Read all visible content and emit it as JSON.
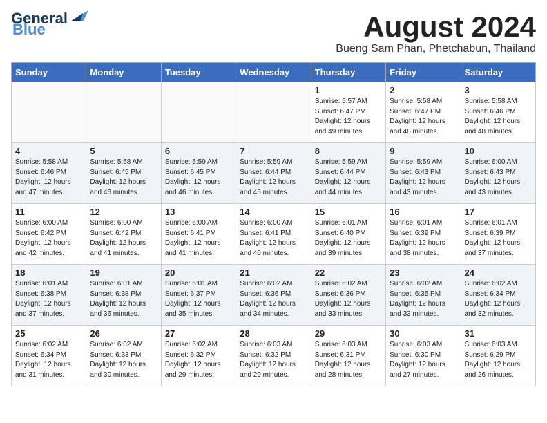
{
  "header": {
    "logo_line1": "General",
    "logo_line2": "Blue",
    "month_title": "August 2024",
    "subtitle": "Bueng Sam Phan, Phetchabun, Thailand"
  },
  "days_of_week": [
    "Sunday",
    "Monday",
    "Tuesday",
    "Wednesday",
    "Thursday",
    "Friday",
    "Saturday"
  ],
  "weeks": [
    [
      {
        "day": "",
        "info": ""
      },
      {
        "day": "",
        "info": ""
      },
      {
        "day": "",
        "info": ""
      },
      {
        "day": "",
        "info": ""
      },
      {
        "day": "1",
        "info": "Sunrise: 5:57 AM\nSunset: 6:47 PM\nDaylight: 12 hours\nand 49 minutes."
      },
      {
        "day": "2",
        "info": "Sunrise: 5:58 AM\nSunset: 6:47 PM\nDaylight: 12 hours\nand 48 minutes."
      },
      {
        "day": "3",
        "info": "Sunrise: 5:58 AM\nSunset: 6:46 PM\nDaylight: 12 hours\nand 48 minutes."
      }
    ],
    [
      {
        "day": "4",
        "info": "Sunrise: 5:58 AM\nSunset: 6:46 PM\nDaylight: 12 hours\nand 47 minutes."
      },
      {
        "day": "5",
        "info": "Sunrise: 5:58 AM\nSunset: 6:45 PM\nDaylight: 12 hours\nand 46 minutes."
      },
      {
        "day": "6",
        "info": "Sunrise: 5:59 AM\nSunset: 6:45 PM\nDaylight: 12 hours\nand 46 minutes."
      },
      {
        "day": "7",
        "info": "Sunrise: 5:59 AM\nSunset: 6:44 PM\nDaylight: 12 hours\nand 45 minutes."
      },
      {
        "day": "8",
        "info": "Sunrise: 5:59 AM\nSunset: 6:44 PM\nDaylight: 12 hours\nand 44 minutes."
      },
      {
        "day": "9",
        "info": "Sunrise: 5:59 AM\nSunset: 6:43 PM\nDaylight: 12 hours\nand 43 minutes."
      },
      {
        "day": "10",
        "info": "Sunrise: 6:00 AM\nSunset: 6:43 PM\nDaylight: 12 hours\nand 43 minutes."
      }
    ],
    [
      {
        "day": "11",
        "info": "Sunrise: 6:00 AM\nSunset: 6:42 PM\nDaylight: 12 hours\nand 42 minutes."
      },
      {
        "day": "12",
        "info": "Sunrise: 6:00 AM\nSunset: 6:42 PM\nDaylight: 12 hours\nand 41 minutes."
      },
      {
        "day": "13",
        "info": "Sunrise: 6:00 AM\nSunset: 6:41 PM\nDaylight: 12 hours\nand 41 minutes."
      },
      {
        "day": "14",
        "info": "Sunrise: 6:00 AM\nSunset: 6:41 PM\nDaylight: 12 hours\nand 40 minutes."
      },
      {
        "day": "15",
        "info": "Sunrise: 6:01 AM\nSunset: 6:40 PM\nDaylight: 12 hours\nand 39 minutes."
      },
      {
        "day": "16",
        "info": "Sunrise: 6:01 AM\nSunset: 6:39 PM\nDaylight: 12 hours\nand 38 minutes."
      },
      {
        "day": "17",
        "info": "Sunrise: 6:01 AM\nSunset: 6:39 PM\nDaylight: 12 hours\nand 37 minutes."
      }
    ],
    [
      {
        "day": "18",
        "info": "Sunrise: 6:01 AM\nSunset: 6:38 PM\nDaylight: 12 hours\nand 37 minutes."
      },
      {
        "day": "19",
        "info": "Sunrise: 6:01 AM\nSunset: 6:38 PM\nDaylight: 12 hours\nand 36 minutes."
      },
      {
        "day": "20",
        "info": "Sunrise: 6:01 AM\nSunset: 6:37 PM\nDaylight: 12 hours\nand 35 minutes."
      },
      {
        "day": "21",
        "info": "Sunrise: 6:02 AM\nSunset: 6:36 PM\nDaylight: 12 hours\nand 34 minutes."
      },
      {
        "day": "22",
        "info": "Sunrise: 6:02 AM\nSunset: 6:36 PM\nDaylight: 12 hours\nand 33 minutes."
      },
      {
        "day": "23",
        "info": "Sunrise: 6:02 AM\nSunset: 6:35 PM\nDaylight: 12 hours\nand 33 minutes."
      },
      {
        "day": "24",
        "info": "Sunrise: 6:02 AM\nSunset: 6:34 PM\nDaylight: 12 hours\nand 32 minutes."
      }
    ],
    [
      {
        "day": "25",
        "info": "Sunrise: 6:02 AM\nSunset: 6:34 PM\nDaylight: 12 hours\nand 31 minutes."
      },
      {
        "day": "26",
        "info": "Sunrise: 6:02 AM\nSunset: 6:33 PM\nDaylight: 12 hours\nand 30 minutes."
      },
      {
        "day": "27",
        "info": "Sunrise: 6:02 AM\nSunset: 6:32 PM\nDaylight: 12 hours\nand 29 minutes."
      },
      {
        "day": "28",
        "info": "Sunrise: 6:03 AM\nSunset: 6:32 PM\nDaylight: 12 hours\nand 29 minutes."
      },
      {
        "day": "29",
        "info": "Sunrise: 6:03 AM\nSunset: 6:31 PM\nDaylight: 12 hours\nand 28 minutes."
      },
      {
        "day": "30",
        "info": "Sunrise: 6:03 AM\nSunset: 6:30 PM\nDaylight: 12 hours\nand 27 minutes."
      },
      {
        "day": "31",
        "info": "Sunrise: 6:03 AM\nSunset: 6:29 PM\nDaylight: 12 hours\nand 26 minutes."
      }
    ]
  ]
}
